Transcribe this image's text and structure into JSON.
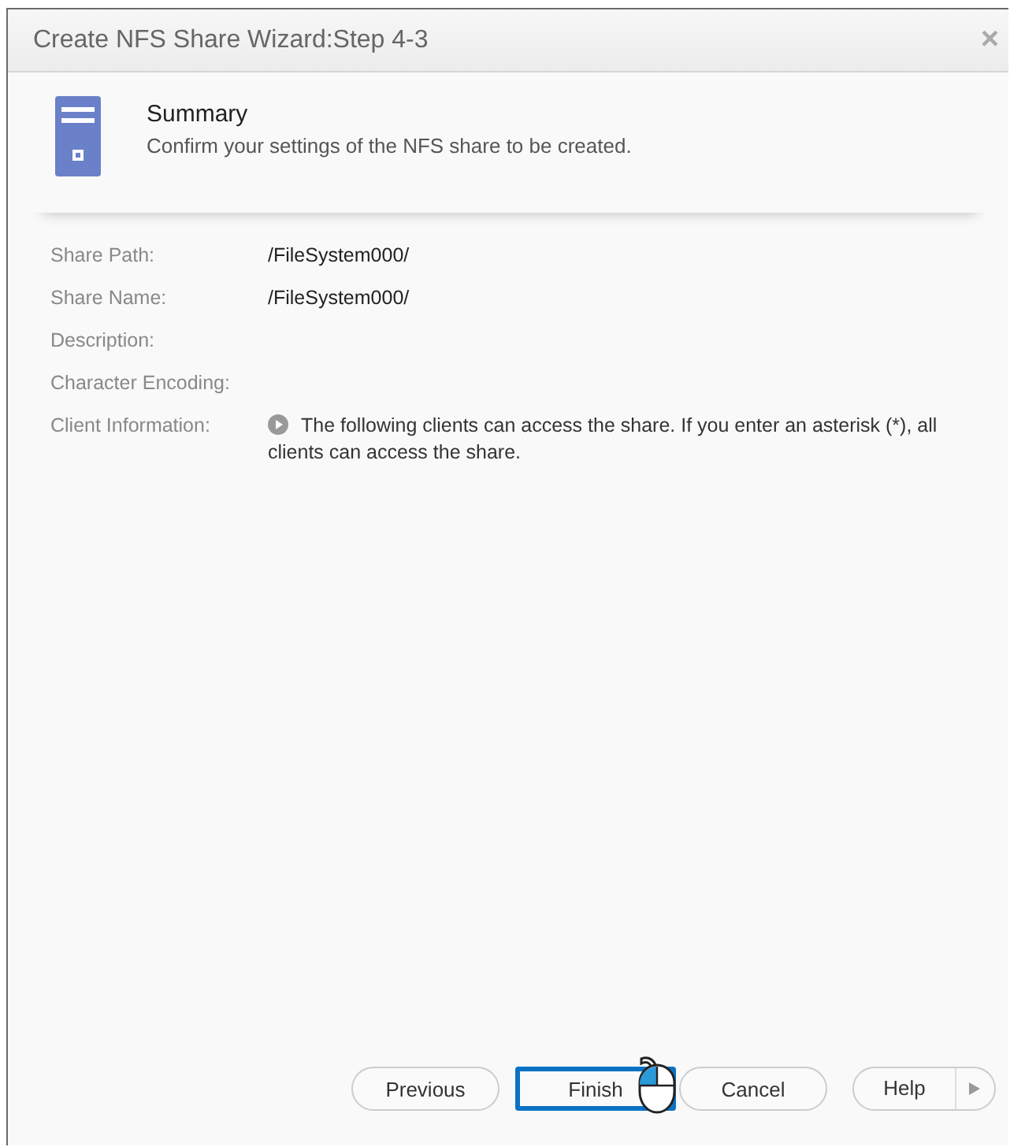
{
  "window": {
    "title": "Create NFS Share Wizard:Step 4-3",
    "close": "×"
  },
  "header": {
    "title": "Summary",
    "subtitle": "Confirm your settings of the NFS share to be created."
  },
  "fields": [
    {
      "label": "Share Path:",
      "value": "/FileSystem000/"
    },
    {
      "label": "Share Name:",
      "value": "/FileSystem000/"
    },
    {
      "label": "Description:"
    },
    {
      "label": "Character Encoding:"
    },
    {
      "label": "Client Information:",
      "note": "The following clients can access the share. If you enter an asterisk (*), all clients can access the share."
    }
  ],
  "buttons": [
    {
      "label": "Previous",
      "highlighted": false
    },
    {
      "label": "Finish",
      "highlighted": true
    },
    {
      "label": "Cancel",
      "highlighted": false
    }
  ],
  "help": {
    "label": "Help"
  }
}
